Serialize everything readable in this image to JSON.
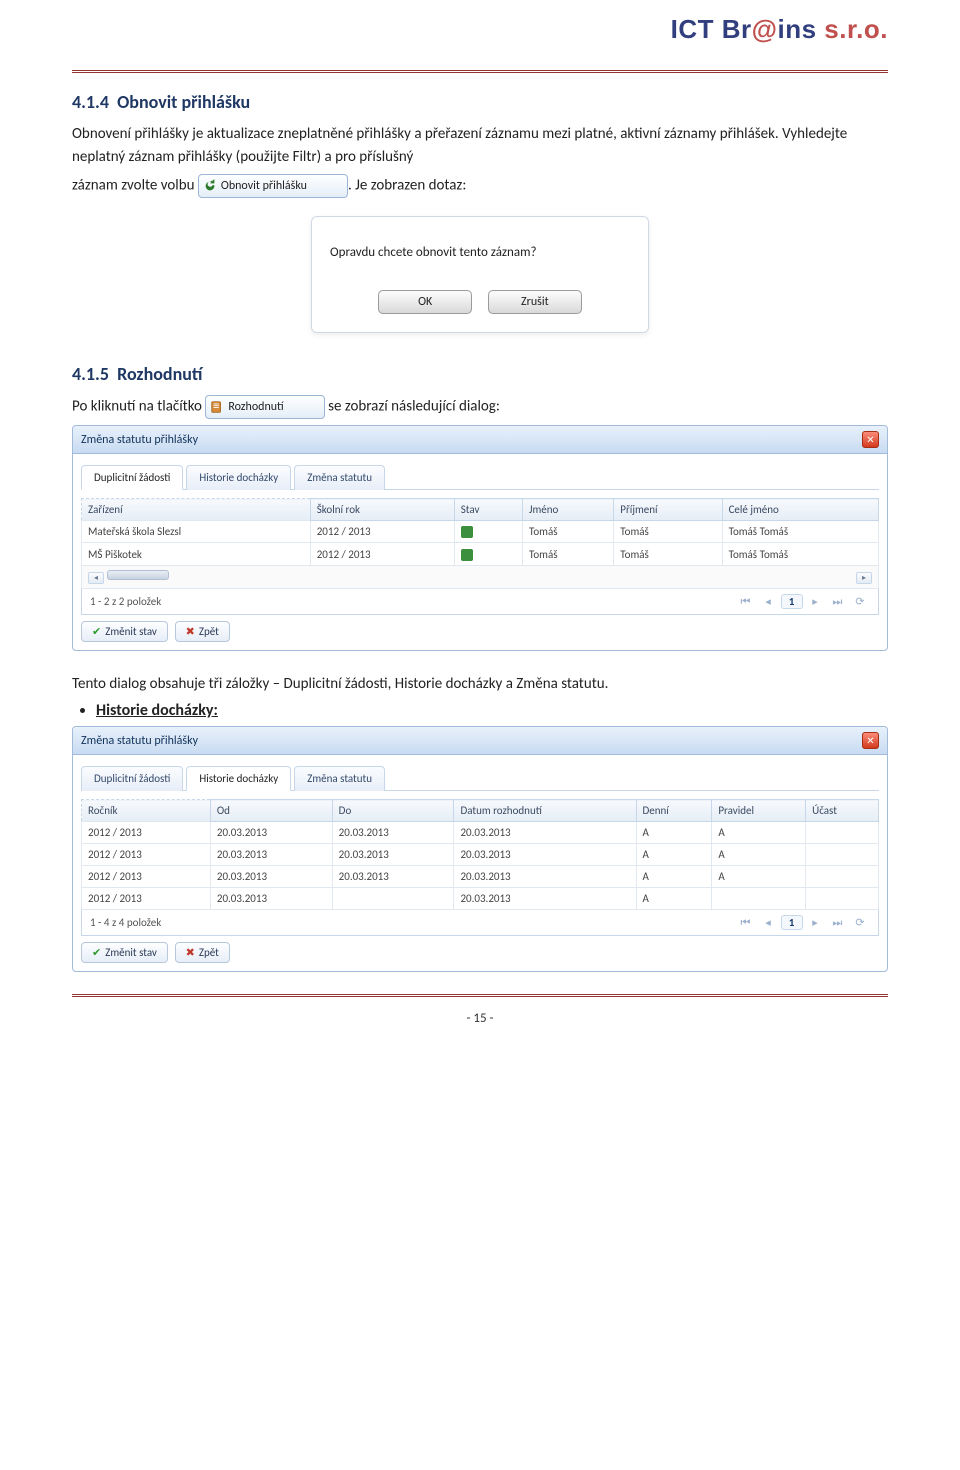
{
  "brand": {
    "pre": "ICT Br",
    "mid": "@",
    "post": "ins ",
    "suffix": "s.r.o."
  },
  "sec1": {
    "num": "4.1.4",
    "title": "Obnovit přihlášku",
    "para1": "Obnovení přihlášky je aktualizace zneplatněné přihlášky a přeřazení záznamu mezi platné, aktivní záznamy přihlášek. Vyhledejte neplatný záznam přihlášky (použijte Filtr) a pro příslušný",
    "para2a": "záznam zvolte volbu ",
    "btn": "Obnovit přihlášku",
    "para2b": ". Je zobrazen dotaz:"
  },
  "confirm": {
    "msg": "Opravdu chcete obnovit tento záznam?",
    "ok": "OK",
    "cancel": "Zrušit"
  },
  "sec2": {
    "num": "4.1.5",
    "title": "Rozhodnutí",
    "para_a": "Po kliknutí na tlačítko ",
    "btn": "Rozhodnutí",
    "para_b": " se zobrazí následující dialog:"
  },
  "dlg": {
    "title": "Změna statutu přihlášky",
    "tabs": [
      "Duplicitní žádosti",
      "Historie docházky",
      "Změna statutu"
    ],
    "dup_headers": [
      "Zařízení",
      "Školní rok",
      "Stav",
      "Jméno",
      "Příjmení",
      "Celé jméno"
    ],
    "dup_rows": [
      [
        "Mateřská škola Slezsl",
        "2012 / 2013",
        "",
        "Tomáš",
        "Tomáš",
        "Tomáš Tomáš"
      ],
      [
        "MŠ Piškotek",
        "2012 / 2013",
        "",
        "Tomáš",
        "Tomáš",
        "Tomáš Tomáš"
      ]
    ],
    "pager_dup": "1 - 2 z 2 položek",
    "hist_headers": [
      "Ročník",
      "Od",
      "Do",
      "Datum rozhodnutí",
      "Denní",
      "Pravidel",
      "Účast"
    ],
    "hist_rows": [
      [
        "2012 / 2013",
        "20.03.2013",
        "20.03.2013",
        "20.03.2013",
        "A",
        "A",
        ""
      ],
      [
        "2012 / 2013",
        "20.03.2013",
        "20.03.2013",
        "20.03.2013",
        "A",
        "A",
        ""
      ],
      [
        "2012 / 2013",
        "20.03.2013",
        "20.03.2013",
        "20.03.2013",
        "A",
        "A",
        ""
      ],
      [
        "2012 / 2013",
        "20.03.2013",
        "",
        "20.03.2013",
        "A",
        "",
        ""
      ]
    ],
    "pager_hist": "1 - 4 z 4 položek",
    "btn_change": "Změnit stav",
    "btn_back": "Zpět"
  },
  "mid_para": "Tento dialog obsahuje tři záložky – Duplicitní žádosti, Historie docházky a Změna statutu.",
  "bullet": "Historie docházky:",
  "page_num": "- 15 -"
}
